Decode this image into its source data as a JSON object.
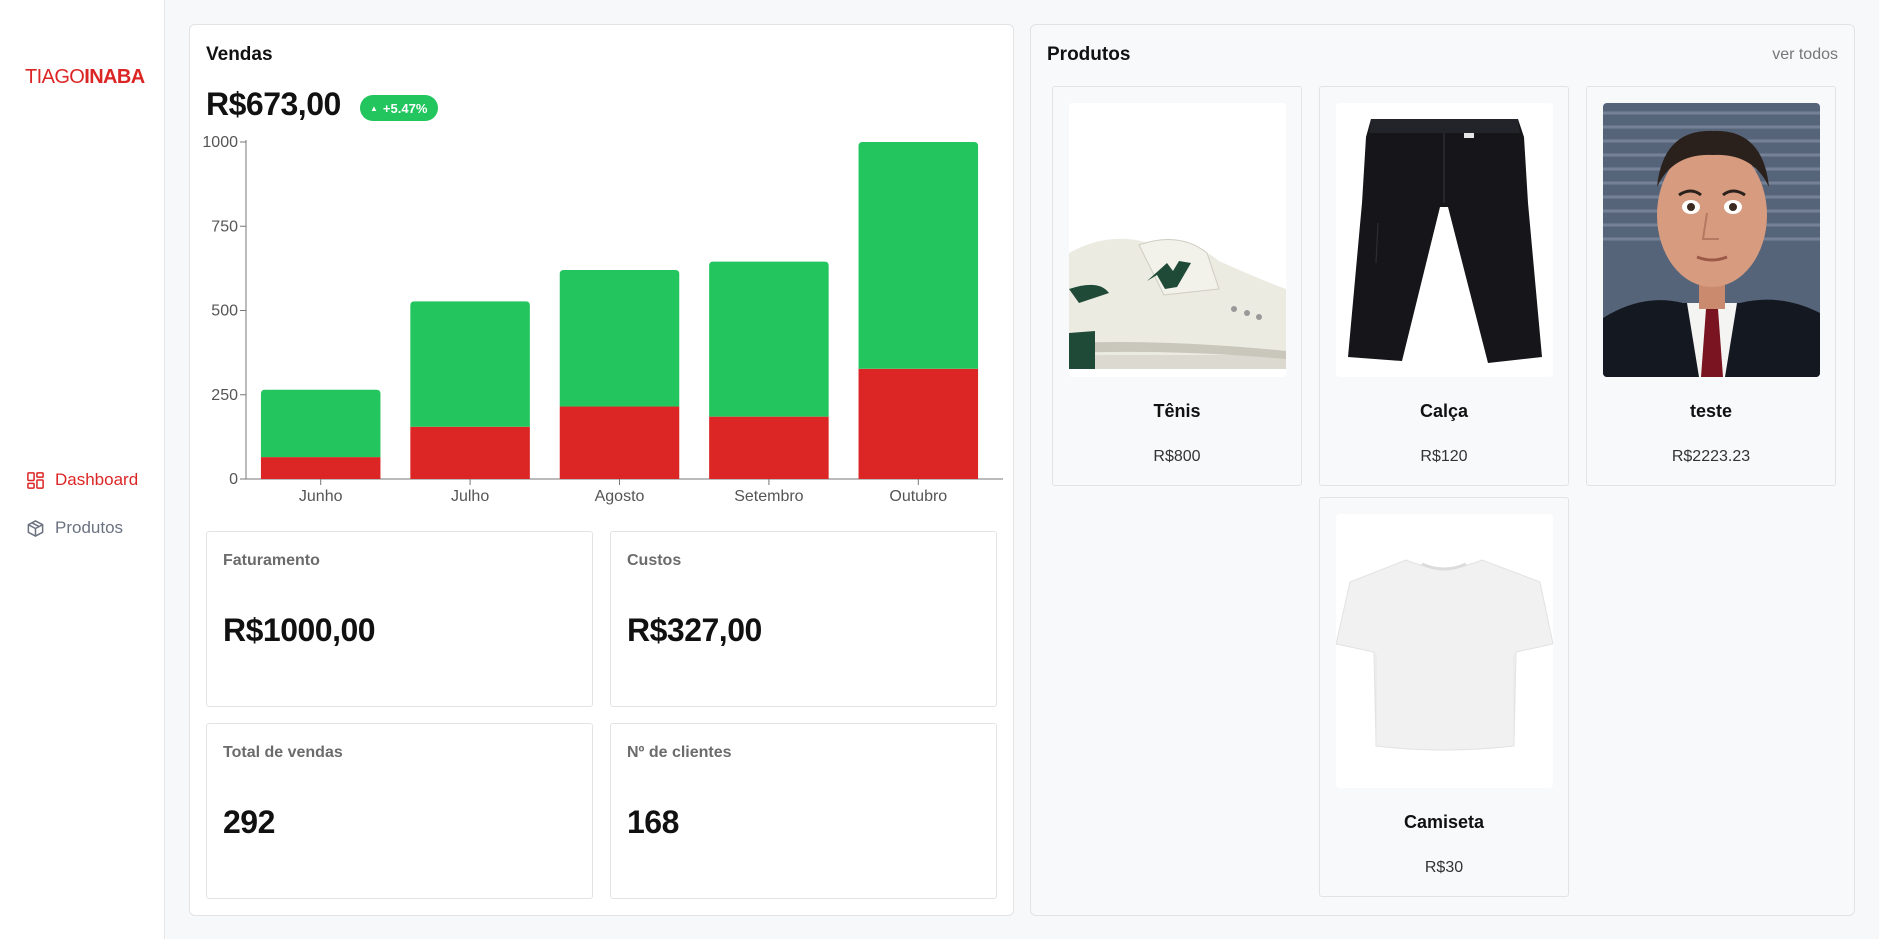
{
  "brand": {
    "part1": "TIAGO",
    "part2": "INABA",
    "color": "#dc2626"
  },
  "sidebar": {
    "items": [
      {
        "label": "Dashboard",
        "icon": "dashboard-grid-icon",
        "active": true
      },
      {
        "label": "Produtos",
        "icon": "package-icon",
        "active": false
      }
    ]
  },
  "sales": {
    "title": "Vendas",
    "total": "R$673,00",
    "trend": "+5.47%",
    "trend_color": "#22c55e"
  },
  "chart_data": {
    "type": "bar",
    "stacked": true,
    "categories": [
      "Junho",
      "Julho",
      "Agosto",
      "Setembro",
      "Outubro"
    ],
    "series": [
      {
        "values": [
          65,
          155,
          215,
          185,
          327
        ],
        "color": "#dc2626"
      },
      {
        "values": [
          265,
          527,
          620,
          645,
          1000
        ],
        "color": "#22c55e"
      }
    ],
    "yticks": [
      0,
      250,
      500,
      750,
      1000
    ],
    "ylim": [
      0,
      1000
    ],
    "title": "",
    "xlabel": "",
    "ylabel": ""
  },
  "stats": [
    {
      "label": "Faturamento",
      "value": "R$1000,00"
    },
    {
      "label": "Custos",
      "value": "R$327,00"
    },
    {
      "label": "Total de vendas",
      "value": "292"
    },
    {
      "label": "Nº de clientes",
      "value": "168"
    }
  ],
  "products": {
    "title": "Produtos",
    "see_all": "ver todos",
    "items": [
      {
        "name": "Tênis",
        "price": "R$800",
        "image": "sneaker-image"
      },
      {
        "name": "Calça",
        "price": "R$120",
        "image": "pants-image"
      },
      {
        "name": "teste",
        "price": "R$2223.23",
        "image": "person-photo"
      },
      {
        "name": "Camiseta",
        "price": "R$30",
        "image": "tshirt-image"
      }
    ]
  }
}
